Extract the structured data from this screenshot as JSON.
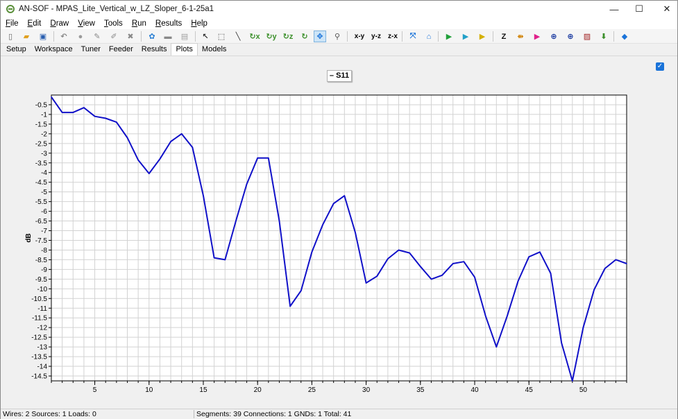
{
  "window": {
    "title": "AN-SOF - MPAS_Lite_Vertical_w_LZ_Sloper_6-1-25a1",
    "minimize": "—",
    "maximize": "☐",
    "close": "✕"
  },
  "menu": [
    {
      "pre": "",
      "u": "F",
      "post": "ile"
    },
    {
      "pre": "",
      "u": "E",
      "post": "dit"
    },
    {
      "pre": "",
      "u": "D",
      "post": "raw"
    },
    {
      "pre": "",
      "u": "V",
      "post": "iew"
    },
    {
      "pre": "",
      "u": "T",
      "post": "ools"
    },
    {
      "pre": "",
      "u": "R",
      "post": "un"
    },
    {
      "pre": "",
      "u": "R",
      "post": "esults"
    },
    {
      "pre": "",
      "u": "H",
      "post": "elp"
    }
  ],
  "toolbar": {
    "view_labels": {
      "xy": "x-y",
      "yz": "y-z",
      "zx": "z-x"
    },
    "icons": [
      {
        "name": "new-file-icon",
        "glyph": "▯",
        "color": "#666666"
      },
      {
        "name": "open-folder-icon",
        "glyph": "▰",
        "color": "#e0a020"
      },
      {
        "name": "save-icon",
        "glyph": "▣",
        "color": "#2a5fb0"
      },
      {
        "name": "undo-icon",
        "glyph": "↶",
        "color": "#888888"
      },
      {
        "name": "stop-icon",
        "glyph": "●",
        "color": "#9a9a9a"
      },
      {
        "name": "pencil-icon",
        "glyph": "✎",
        "color": "#888888"
      },
      {
        "name": "edit-icon",
        "glyph": "✐",
        "color": "#888888"
      },
      {
        "name": "delete-icon",
        "glyph": "✖",
        "color": "#888888"
      },
      {
        "name": "settings-icon",
        "glyph": "✿",
        "color": "#2a7fd4"
      },
      {
        "name": "comment-icon",
        "glyph": "▬",
        "color": "#888888"
      },
      {
        "name": "notes-icon",
        "glyph": "▤",
        "color": "#a0a0a0"
      },
      {
        "name": "pointer-icon",
        "glyph": "↖",
        "color": "#333333"
      },
      {
        "name": "select-rect-icon",
        "glyph": "⬚",
        "color": "#333333"
      },
      {
        "name": "line-icon",
        "glyph": "╲",
        "color": "#333333"
      },
      {
        "name": "rotate-x-icon",
        "glyph": "↻x",
        "color": "#3b8f2a"
      },
      {
        "name": "rotate-y-icon",
        "glyph": "↻y",
        "color": "#3b8f2a"
      },
      {
        "name": "rotate-z-icon",
        "glyph": "↻z",
        "color": "#3b8f2a"
      },
      {
        "name": "rotate-3d-icon",
        "glyph": "↻",
        "color": "#3b8f2a"
      },
      {
        "name": "pan-icon",
        "glyph": "✥",
        "color": "#1a73d9"
      },
      {
        "name": "zoom-icon",
        "glyph": "⚲",
        "color": "#555555"
      },
      {
        "name": "fit-icon",
        "glyph": "⤧",
        "color": "#1a73d9"
      },
      {
        "name": "home-icon",
        "glyph": "⌂",
        "color": "#1a73d9"
      },
      {
        "name": "run-icon",
        "glyph": "▶",
        "color": "#22a03a"
      },
      {
        "name": "run-step-icon",
        "glyph": "▶",
        "color": "#22a0c8"
      },
      {
        "name": "run-sweep-icon",
        "glyph": "▶",
        "color": "#d4b000"
      },
      {
        "name": "impedance-icon",
        "glyph": "Z",
        "color": "#111111"
      },
      {
        "name": "current-icon",
        "glyph": "⇻",
        "color": "#d08000"
      },
      {
        "name": "color-map-icon",
        "glyph": "▶",
        "color": "#e0208a"
      },
      {
        "name": "pattern-icon",
        "glyph": "⊕",
        "color": "#1a3aa0"
      },
      {
        "name": "pattern-2d-icon",
        "glyph": "⊕",
        "color": "#1a3aa0"
      },
      {
        "name": "chart-icon",
        "glyph": "▨",
        "color": "#a02020"
      },
      {
        "name": "download-icon",
        "glyph": "⬇",
        "color": "#3b8f2a"
      },
      {
        "name": "book-icon",
        "glyph": "◆",
        "color": "#1a73d9"
      }
    ]
  },
  "tabs": [
    "Setup",
    "Workspace",
    "Tuner",
    "Feeder",
    "Results",
    "Plots",
    "Models"
  ],
  "active_tab": "Plots",
  "legend_label": "– S11",
  "status": {
    "left": "Wires: 2  Sources: 1  Loads: 0",
    "right": "Segments: 39  Connections: 1  GNDs: 1  Total: 41"
  },
  "chart_data": {
    "type": "line",
    "title": "",
    "xlabel": "",
    "ylabel": "dB",
    "xlim": [
      1,
      54
    ],
    "ylim": [
      -14.75,
      0
    ],
    "x_ticks": [
      5,
      10,
      15,
      20,
      25,
      30,
      35,
      40,
      45,
      50
    ],
    "y_ticks": [
      -0.5,
      -1,
      -1.5,
      -2,
      -2.5,
      -3,
      -3.5,
      -4,
      -4.5,
      -5,
      -5.5,
      -6,
      -6.5,
      -7,
      -7.5,
      -8,
      -8.5,
      -9,
      -9.5,
      -10,
      -10.5,
      -11,
      -11.5,
      -12,
      -12.5,
      -13,
      -13.5,
      -14,
      -14.5
    ],
    "grid": true,
    "series": [
      {
        "name": "S11",
        "color": "#1010c8",
        "x": [
          1,
          2,
          3,
          4,
          5,
          6,
          7,
          8,
          9,
          10,
          11,
          12,
          13,
          14,
          15,
          16,
          17,
          18,
          19,
          20,
          21,
          22,
          23,
          24,
          25,
          26,
          27,
          28,
          29,
          30,
          31,
          32,
          33,
          34,
          35,
          36,
          37,
          38,
          39,
          40,
          41,
          42,
          43,
          44,
          45,
          46,
          47,
          48,
          49,
          50,
          51,
          52,
          53,
          54
        ],
        "y": [
          -0.1,
          -0.9,
          -0.9,
          -0.65,
          -1.1,
          -1.2,
          -1.4,
          -2.2,
          -3.35,
          -4.05,
          -3.3,
          -2.4,
          -2.0,
          -2.7,
          -5.2,
          -8.4,
          -8.5,
          -6.5,
          -4.6,
          -3.25,
          -3.25,
          -6.5,
          -10.9,
          -10.1,
          -8.1,
          -6.7,
          -5.6,
          -5.2,
          -7.1,
          -9.7,
          -9.35,
          -8.45,
          -8.0,
          -8.15,
          -8.85,
          -9.5,
          -9.3,
          -8.7,
          -8.6,
          -9.4,
          -11.4,
          -13.0,
          -11.4,
          -9.6,
          -8.35,
          -8.1,
          -9.2,
          -12.8,
          -14.75,
          -12.0,
          -10.05,
          -8.95,
          -8.5,
          -8.7
        ]
      }
    ]
  }
}
